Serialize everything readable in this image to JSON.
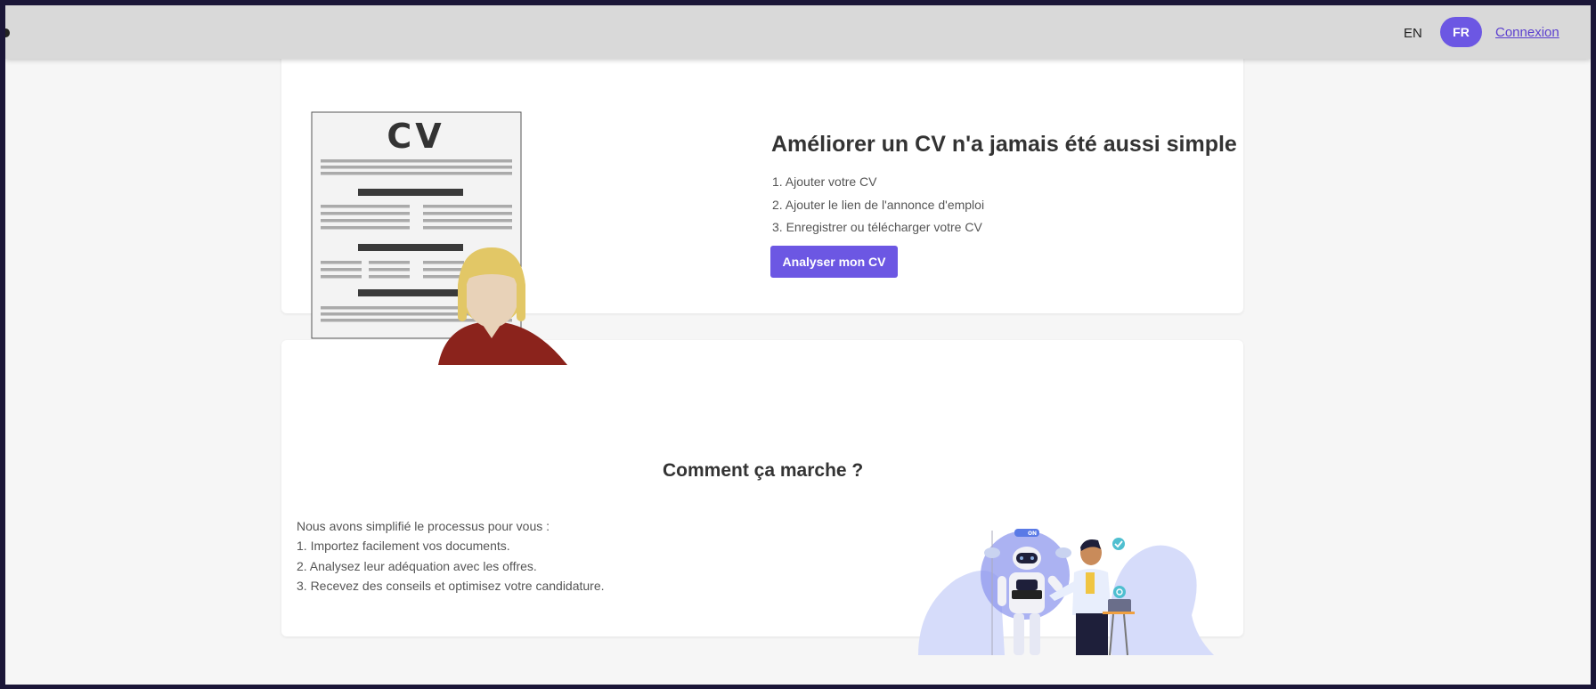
{
  "header": {
    "lang_en": "EN",
    "lang_fr": "FR",
    "login": "Connexion"
  },
  "hero": {
    "cv_label": "CV",
    "title": "Améliorer un CV n'a jamais été aussi simple",
    "steps": [
      "1. Ajouter votre CV",
      "2. Ajouter le lien de l'annonce d'emploi",
      "3. Enregistrer ou télécharger votre CV"
    ],
    "cta": "Analyser mon CV"
  },
  "how_it_works": {
    "title": "Comment ça marche ?",
    "intro": "Nous avons simplifié le processus pour vous :",
    "lines": [
      "1. Importez facilement vos documents.",
      "2. Analysez leur adéquation avec les offres.",
      "3. Recevez des conseils et optimisez votre candidature."
    ],
    "robot_badge": "ON"
  },
  "colors": {
    "accent": "#6c57e3",
    "header_bg": "#d9d9d9",
    "page_bg": "#f6f6f6",
    "hair": "#e2c766",
    "shirt": "#8b231c",
    "blob": "#d6dcfa"
  }
}
